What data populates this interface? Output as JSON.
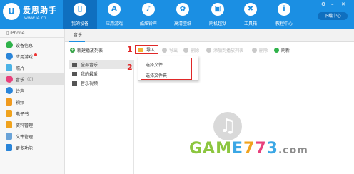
{
  "app": {
    "title": "爱思助手",
    "url": "www.i4.cn"
  },
  "nav": [
    {
      "label": "我的设备",
      "icon": "apple-icon"
    },
    {
      "label": "应用游戏",
      "icon": "app-store-icon"
    },
    {
      "label": "酷炫铃声",
      "icon": "bell-icon"
    },
    {
      "label": "高清壁纸",
      "icon": "flower-icon"
    },
    {
      "label": "刷机越狱",
      "icon": "box-icon"
    },
    {
      "label": "工具箱",
      "icon": "wrench-icon"
    },
    {
      "label": "教程中心",
      "icon": "info-icon"
    }
  ],
  "download_center": "下载中心",
  "device": {
    "name": "iPhone"
  },
  "sidebar": [
    {
      "label": "设备信息",
      "color": "#2fb24a"
    },
    {
      "label": "应用游戏",
      "color": "#2a85d9"
    },
    {
      "label": "照片",
      "color": "#4cb3e6"
    },
    {
      "label": "音乐",
      "count": "(0)",
      "color": "#e8407c"
    },
    {
      "label": "铃声",
      "color": "#2a85d9"
    },
    {
      "label": "视频",
      "color": "#f09a1e"
    },
    {
      "label": "电子书",
      "color": "#f0a31e"
    },
    {
      "label": "资料管理",
      "color": "#f0a31e"
    },
    {
      "label": "文件管理",
      "color": "#6aa3d8"
    },
    {
      "label": "更多功能",
      "color": "#2a85d9"
    }
  ],
  "tab": "音乐",
  "toolbar": {
    "new_playlist": "新建播放列表",
    "import": "导入",
    "export": "导出",
    "delete": "删除",
    "add_to": "添加到播放列表",
    "remove": "删除",
    "refresh": "刷新"
  },
  "categories": [
    "全部音乐",
    "我的最爱",
    "音乐视频"
  ],
  "dropdown": [
    "选择文件",
    "选择文件夹"
  ],
  "markers": [
    "1",
    "2"
  ],
  "watermark": {
    "text": "GAME773.com"
  },
  "colors": {
    "brand": "#1b8fe3",
    "highlight": "#e02828"
  }
}
